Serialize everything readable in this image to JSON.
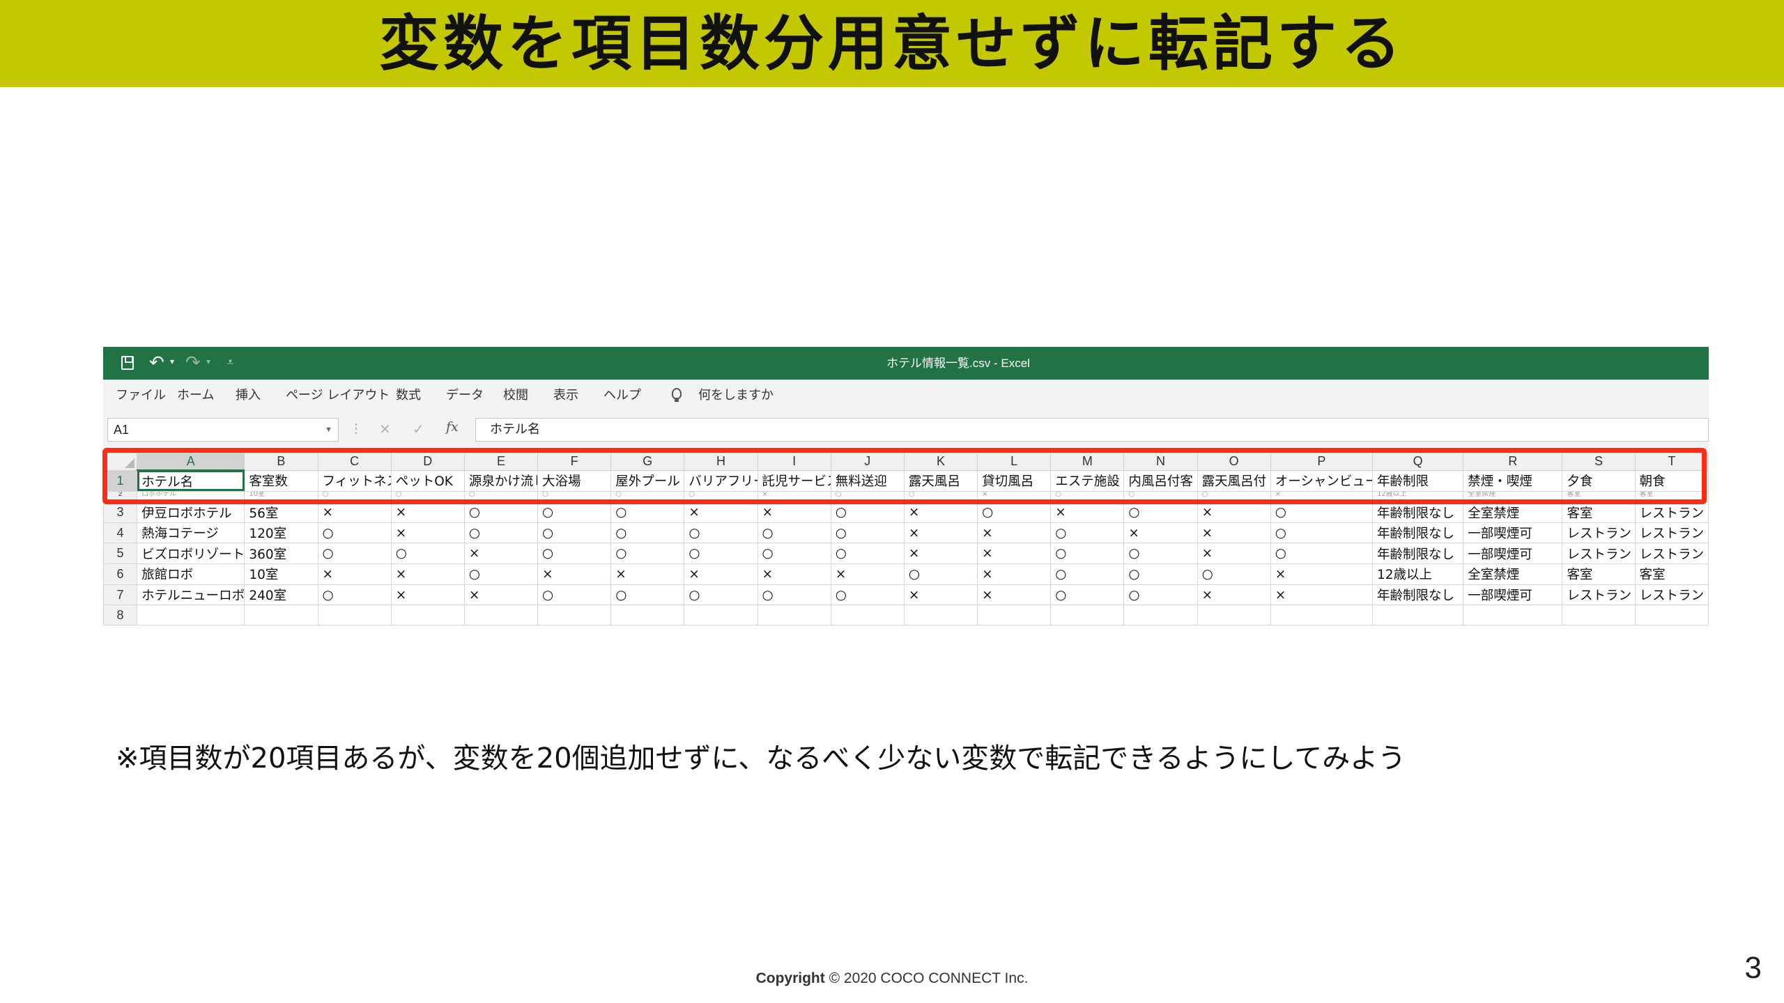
{
  "slide": {
    "title": "変数を項目数分用意せずに転記する",
    "note": "※項目数が20項目あるが、変数を20個追加せずに、なるべく少ない変数で転記できるようにしてみよう",
    "copyright_label": "Copyright",
    "copyright_text": "© 2020 COCO CONNECT Inc.",
    "page_number": "3",
    "highlight_color": "#ff2b17",
    "banner_color": "#c4c800"
  },
  "excel": {
    "window_title": "ホテル情報一覧.csv  -  Excel",
    "accent_color": "#217346",
    "ribbon_tabs": [
      "ファイル",
      "ホーム",
      "挿入",
      "ページ レイアウト",
      "数式",
      "データ",
      "校閲",
      "表示",
      "ヘルプ"
    ],
    "tell_me": "何をしますか",
    "name_box": "A1",
    "formula": "ホテル名",
    "columns": [
      "A",
      "B",
      "C",
      "D",
      "E",
      "F",
      "G",
      "H",
      "I",
      "J",
      "K",
      "L",
      "M",
      "N",
      "O",
      "P",
      "Q",
      "R",
      "S",
      "T"
    ],
    "rows": [
      [
        "ホテル名",
        "客室数",
        "フィットネス",
        "ペットOK",
        "源泉かけ流し",
        "大浴場",
        "屋外プール",
        "バリアフリー",
        "託児サービス",
        "無料送迎",
        "露天風呂",
        "貸切風呂",
        "エステ施設",
        "内風呂付客",
        "露天風呂付",
        "オーシャンビュー",
        "年齢制限",
        "禁煙・喫煙",
        "夕食",
        "朝食"
      ],
      [
        "ロボホテル",
        "10室",
        "○",
        "○",
        "○",
        "○",
        "○",
        "○",
        "×",
        "○",
        "○",
        "×",
        "○",
        "○",
        "○",
        "×",
        "12歳以上",
        "全室禁煙",
        "客室",
        "客室"
      ],
      [
        "伊豆ロボホテル",
        "56室",
        "×",
        "×",
        "○",
        "○",
        "○",
        "×",
        "×",
        "○",
        "×",
        "○",
        "×",
        "○",
        "×",
        "○",
        "年齢制限なし",
        "全室禁煙",
        "客室",
        "レストラン"
      ],
      [
        "熱海コテージ",
        "120室",
        "○",
        "×",
        "○",
        "○",
        "○",
        "○",
        "○",
        "○",
        "×",
        "×",
        "○",
        "×",
        "×",
        "○",
        "年齢制限なし",
        "一部喫煙可",
        "レストラン",
        "レストラン"
      ],
      [
        "ビズロボリゾート",
        "360室",
        "○",
        "○",
        "×",
        "○",
        "○",
        "○",
        "○",
        "○",
        "×",
        "×",
        "○",
        "○",
        "×",
        "○",
        "年齢制限なし",
        "一部喫煙可",
        "レストラン",
        "レストラン"
      ],
      [
        "旅館ロボ",
        "10室",
        "×",
        "×",
        "○",
        "×",
        "×",
        "×",
        "×",
        "×",
        "○",
        "×",
        "○",
        "○",
        "○",
        "×",
        "12歳以上",
        "全室禁煙",
        "客室",
        "客室"
      ],
      [
        "ホテルニューロボ",
        "240室",
        "○",
        "×",
        "×",
        "○",
        "○",
        "○",
        "○",
        "○",
        "×",
        "×",
        "○",
        "○",
        "×",
        "×",
        "年齢制限なし",
        "一部喫煙可",
        "レストラン",
        "レストラン"
      ],
      [
        "",
        "",
        "",
        "",
        "",
        "",
        "",
        "",
        "",
        "",
        "",
        "",
        "",
        "",
        "",
        "",
        "",
        "",
        "",
        ""
      ]
    ]
  }
}
